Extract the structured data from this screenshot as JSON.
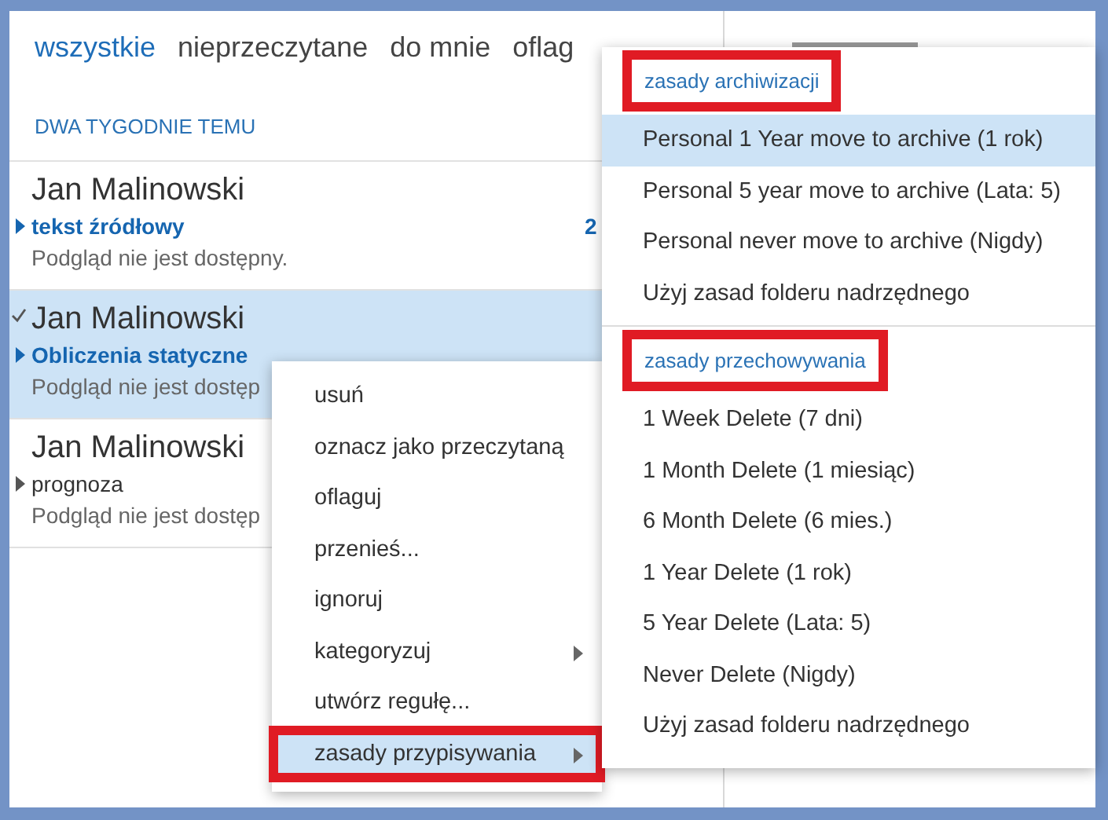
{
  "filter_tabs": [
    {
      "label": "wszystkie",
      "selected": true
    },
    {
      "label": "nieprzeczytane",
      "selected": false
    },
    {
      "label": "do mnie",
      "selected": false
    },
    {
      "label": "oflag",
      "selected": false
    }
  ],
  "group_header": "DWA TYGODNIE TEMU",
  "messages": [
    {
      "sender": "Jan Malinowski",
      "subject": "tekst źródłowy",
      "preview": "Podgląd nie jest dostępny.",
      "unread": true,
      "selected": false,
      "count": "2"
    },
    {
      "sender": "Jan Malinowski",
      "subject": "Obliczenia statyczne",
      "preview": "Podgląd nie jest dostęp",
      "unread": true,
      "selected": true
    },
    {
      "sender": "Jan Malinowski",
      "subject": "prognoza",
      "preview": "Podgląd nie jest dostęp",
      "unread": false,
      "selected": false
    }
  ],
  "context_menu": {
    "items": [
      {
        "label": "usuń",
        "submenu": false,
        "selected": false,
        "framed": false
      },
      {
        "label": "oznacz jako przeczytaną",
        "submenu": false,
        "selected": false,
        "framed": false
      },
      {
        "label": "oflaguj",
        "submenu": false,
        "selected": false,
        "framed": false
      },
      {
        "label": "przenieś...",
        "submenu": false,
        "selected": false,
        "framed": false
      },
      {
        "label": "ignoruj",
        "submenu": false,
        "selected": false,
        "framed": false
      },
      {
        "label": "kategoryzuj",
        "submenu": true,
        "selected": false,
        "framed": false
      },
      {
        "label": "utwórz regułę...",
        "submenu": false,
        "selected": false,
        "framed": false
      },
      {
        "label": "zasady przypisywania",
        "submenu": true,
        "selected": true,
        "framed": true
      }
    ]
  },
  "submenu": {
    "sections": [
      {
        "heading": "zasady archiwizacji",
        "framed": true,
        "items": [
          {
            "label": "Personal 1 Year move to archive (1 rok)",
            "selected": true
          },
          {
            "label": "Personal 5 year move to archive (Lata: 5)",
            "selected": false
          },
          {
            "label": "Personal never move to archive (Nigdy)",
            "selected": false
          },
          {
            "label": "Użyj zasad folderu nadrzędnego",
            "selected": false
          }
        ]
      },
      {
        "heading": "zasady przechowywania",
        "framed": true,
        "items": [
          {
            "label": "1 Week Delete (7 dni)",
            "selected": false
          },
          {
            "label": "1 Month Delete (1 miesiąc)",
            "selected": false
          },
          {
            "label": "6 Month Delete (6 mies.)",
            "selected": false
          },
          {
            "label": "1 Year Delete (1 rok)",
            "selected": false
          },
          {
            "label": "5 Year Delete (Lata: 5)",
            "selected": false
          },
          {
            "label": "Never Delete (Nigdy)",
            "selected": false
          },
          {
            "label": "Użyj zasad folderu nadrzędnego",
            "selected": false
          }
        ]
      }
    ]
  }
}
